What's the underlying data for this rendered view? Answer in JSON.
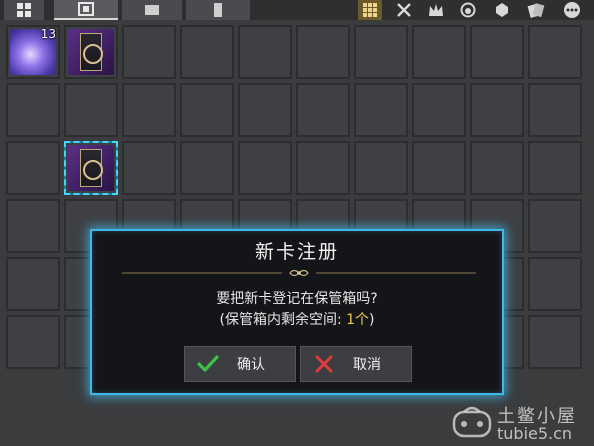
{
  "top_tabs": [
    {
      "icon": "grid-icon",
      "active": false
    },
    {
      "icon": "card-album-icon",
      "active": true
    },
    {
      "icon": "box-icon",
      "active": false
    },
    {
      "icon": "scroll-icon",
      "active": false
    }
  ],
  "tools": [
    {
      "icon": "grid-view-icon",
      "active": true
    },
    {
      "icon": "crossed-tools-icon",
      "active": false
    },
    {
      "icon": "crown-icon",
      "active": false
    },
    {
      "icon": "potion-icon",
      "active": false
    },
    {
      "icon": "gem-icon",
      "active": false
    },
    {
      "icon": "card-stack-icon",
      "active": false
    },
    {
      "icon": "more-icon",
      "active": false
    }
  ],
  "inventory": {
    "orb_count": "13"
  },
  "dialog": {
    "title": "新卡注册",
    "message_line1": "要把新卡登记在保管箱吗?",
    "message_line2_prefix": "(保管箱内剩余空间: ",
    "message_line2_value": "1个",
    "message_line2_suffix": ")",
    "confirm_label": "确认",
    "cancel_label": "取消",
    "accent_color": "#3fb8e8",
    "confirm_icon_color": "#3cc24a",
    "cancel_icon_color": "#e23a3a"
  },
  "watermark": {
    "name": "土鳖小屋",
    "site": "tubie5.cn"
  }
}
